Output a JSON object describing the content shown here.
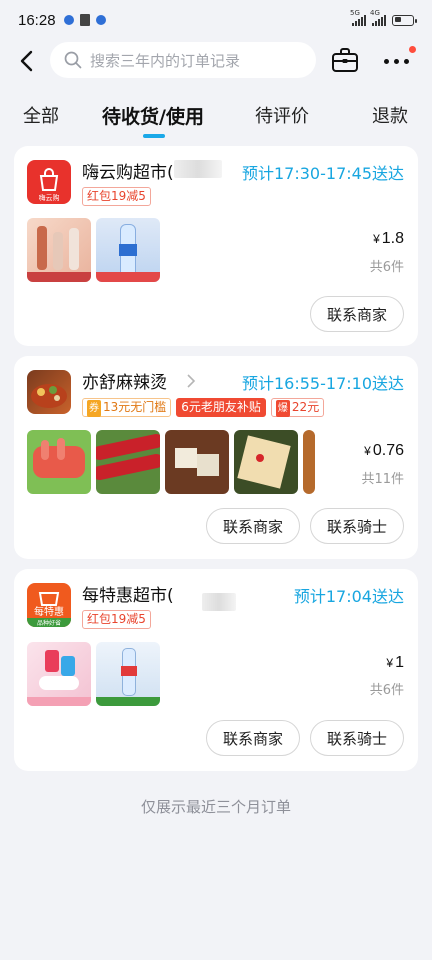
{
  "status_bar": {
    "time": "16:28",
    "network_1": "5G",
    "network_2": "4G"
  },
  "search": {
    "placeholder": "搜索三年内的订单记录"
  },
  "icons": {
    "back": "back-arrow-icon",
    "search": "search-icon",
    "suitcase": "suitcase-icon",
    "more": "more-dots-icon"
  },
  "tabs": [
    {
      "label": "全部"
    },
    {
      "label": "待收货/使用",
      "active": true
    },
    {
      "label": "待评价"
    },
    {
      "label": "退款"
    }
  ],
  "orders": [
    {
      "store_name": "嗨云购超市(",
      "logo_text": "嗨云购",
      "logo_color": "#e8322c",
      "eta": "预计17:30-17:45送达",
      "tags": [
        "红包19减5"
      ],
      "price_symbol": "¥",
      "price": "1.8",
      "count": "共6件",
      "buttons": [
        "联系商家"
      ]
    },
    {
      "store_name": "亦舒麻辣烫",
      "eta": "预计16:55-17:10送达",
      "tags": [
        "13元无门槛",
        "6元老朋友补贴",
        "22元"
      ],
      "tag_badges": [
        "券",
        "爆"
      ],
      "price_symbol": "¥",
      "price": "0.76",
      "count": "共11件",
      "buttons": [
        "联系商家",
        "联系骑士"
      ]
    },
    {
      "store_name": "每特惠超市(",
      "logo_text": "每特惠",
      "logo_subtext": "品种好省",
      "logo_color": "#f05a1e",
      "eta": "预计17:04送达",
      "tags": [
        "红包19减5"
      ],
      "price_symbol": "¥",
      "price": "1",
      "count": "共6件",
      "buttons": [
        "联系商家",
        "联系骑士"
      ]
    }
  ],
  "footer_note": "仅展示最近三个月订单",
  "colors": {
    "accent": "#1aa8e8",
    "eta": "#18a6e0",
    "tag_red": "#e8452e",
    "background": "#f2f3f7"
  }
}
